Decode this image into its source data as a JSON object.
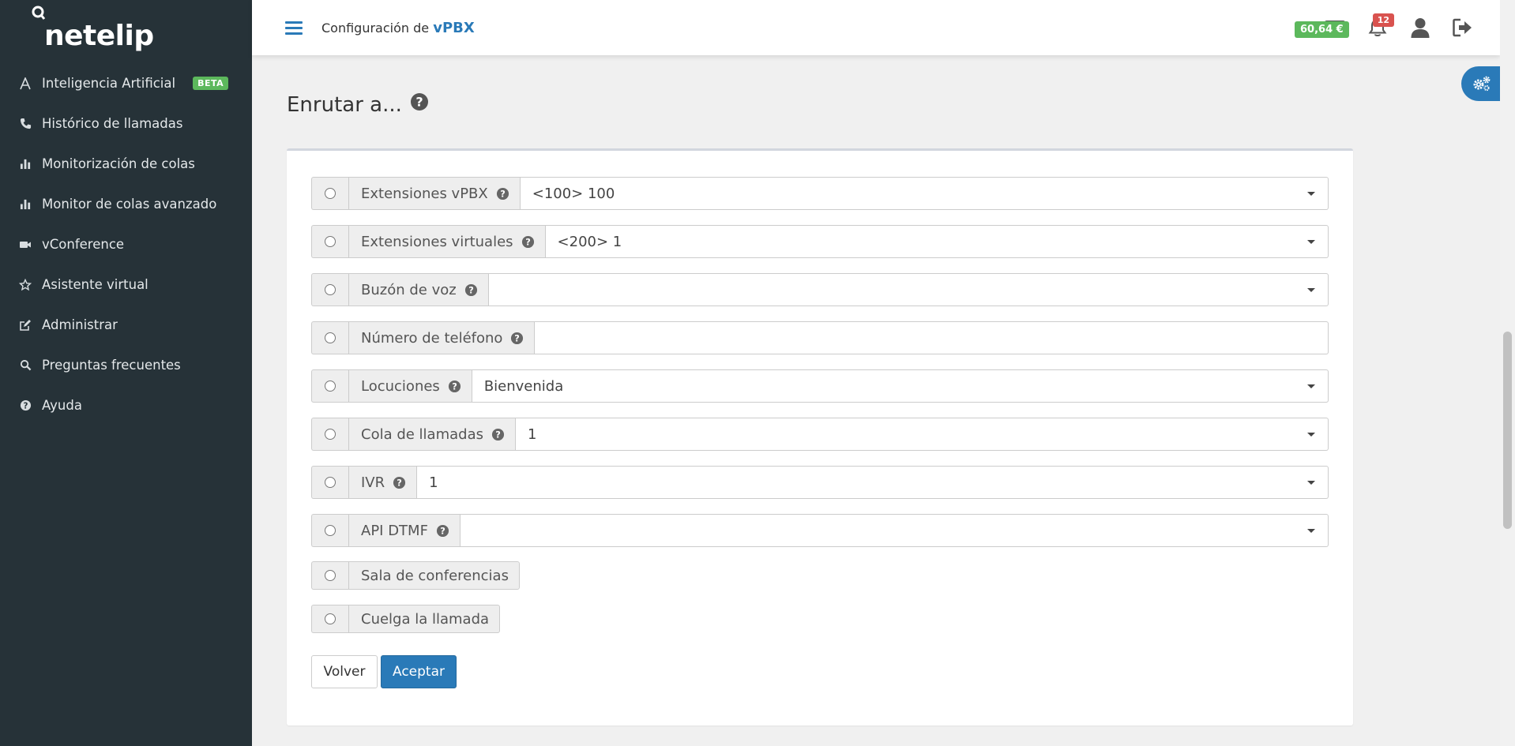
{
  "brand": {
    "name": "netelip"
  },
  "sidebar": {
    "items": [
      {
        "label": "Inteligencia Artificial",
        "icon": "ai-letter-icon",
        "badge": "BETA"
      },
      {
        "label": "Histórico de llamadas",
        "icon": "phone-icon"
      },
      {
        "label": "Monitorización de colas",
        "icon": "bar-chart-icon"
      },
      {
        "label": "Monitor de colas avanzado",
        "icon": "bar-chart-icon"
      },
      {
        "label": "vConference",
        "icon": "video-camera-icon"
      },
      {
        "label": "Asistente virtual",
        "icon": "star-icon"
      },
      {
        "label": "Administrar",
        "icon": "edit-icon"
      },
      {
        "label": "Preguntas frecuentes",
        "icon": "search-icon"
      },
      {
        "label": "Ayuda",
        "icon": "question-circle-icon"
      }
    ]
  },
  "header": {
    "title_prefix": "Configuración de",
    "title_strong": "vPBX",
    "balance": "60,64 €",
    "notifications_count": "12"
  },
  "page": {
    "title": "Enrutar a...",
    "routes": [
      {
        "label": "Extensiones vPBX",
        "type": "select",
        "value": "<100> 100",
        "help": true
      },
      {
        "label": "Extensiones virtuales",
        "type": "select",
        "value": "<200> 1",
        "help": true
      },
      {
        "label": "Buzón de voz",
        "type": "select",
        "value": "",
        "help": true
      },
      {
        "label": "Número de teléfono",
        "type": "input",
        "value": "",
        "help": true
      },
      {
        "label": "Locuciones",
        "type": "select",
        "value": "Bienvenida",
        "help": true
      },
      {
        "label": "Cola de llamadas",
        "type": "select",
        "value": "1",
        "help": true
      },
      {
        "label": "IVR",
        "type": "select",
        "value": "1",
        "help": true
      },
      {
        "label": "API DTMF",
        "type": "select",
        "value": "",
        "help": true
      },
      {
        "label": "Sala de conferencias",
        "type": "none",
        "help": false
      },
      {
        "label": "Cuelga la llamada",
        "type": "none",
        "help": false
      }
    ],
    "buttons": {
      "back": "Volver",
      "accept": "Aceptar"
    }
  },
  "colors": {
    "sidebar_bg": "#263238",
    "accent": "#2a7ab8",
    "success": "#5cb85c",
    "danger": "#d9534f"
  }
}
